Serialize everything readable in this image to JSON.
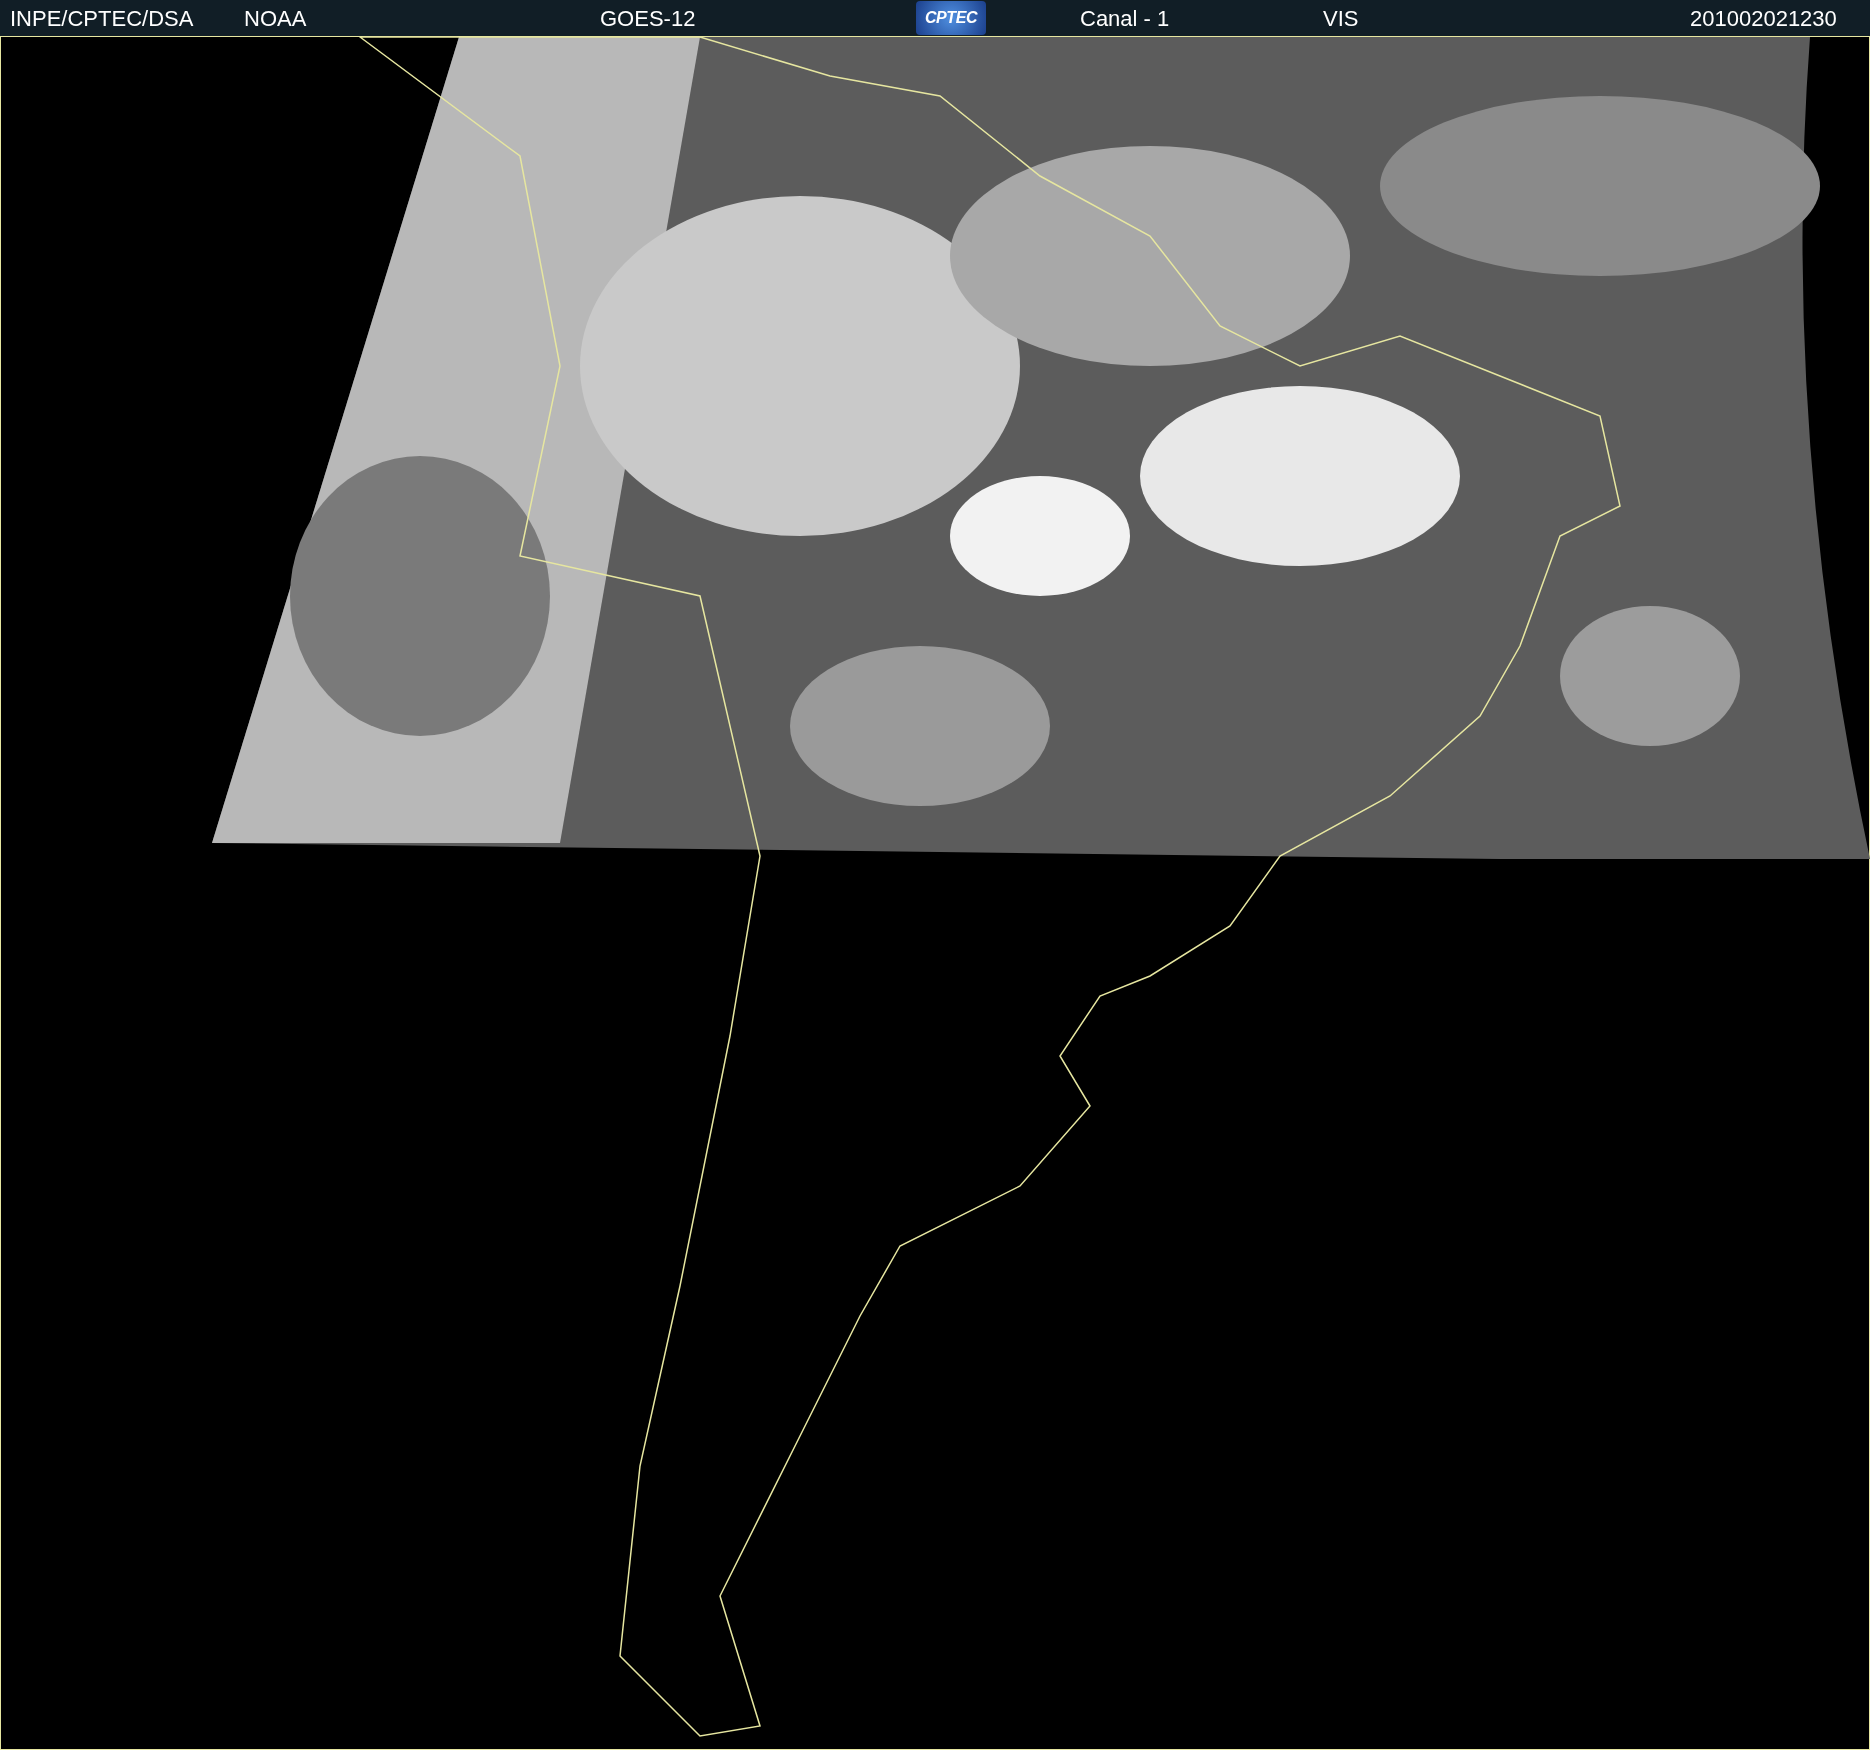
{
  "header": [
    {
      "kind": "text",
      "text": "INPE/CPTEC/DSA"
    },
    {
      "kind": "text",
      "text": "NOAA"
    },
    {
      "kind": "text",
      "text": "GOES-12"
    },
    {
      "kind": "logo",
      "text": "CPTEC"
    },
    {
      "kind": "text",
      "text": "Canal - 1"
    },
    {
      "kind": "text",
      "text": "VIS"
    },
    {
      "kind": "text",
      "text": "201002021230"
    }
  ]
}
